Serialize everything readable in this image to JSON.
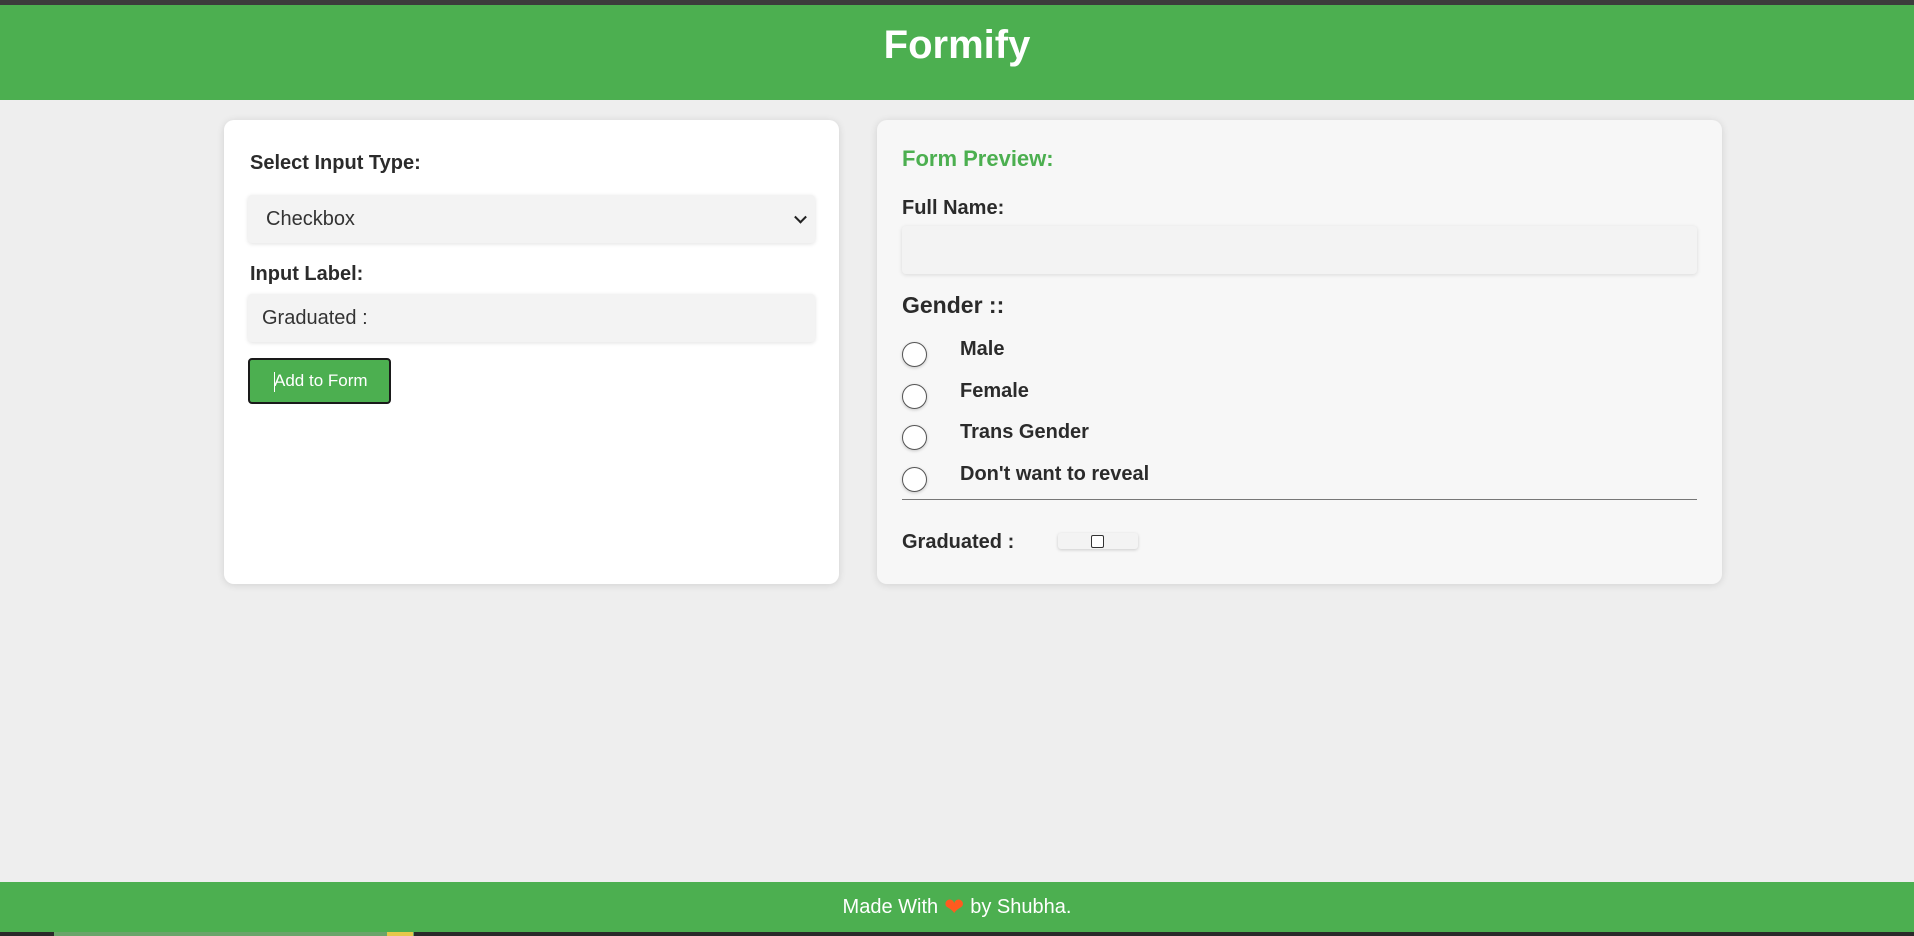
{
  "app": {
    "title": "Formify"
  },
  "builder": {
    "type_label": "Select Input Type:",
    "type_value": "Checkbox",
    "input_label_label": "Input Label:",
    "input_label_value": "Graduated :",
    "add_button": "Add to Form"
  },
  "preview": {
    "title": "Form Preview:",
    "full_name_label": "Full Name:",
    "full_name_value": "",
    "gender_title": "Gender ::",
    "gender_options": [
      {
        "label": "Male",
        "checked": false
      },
      {
        "label": "Female",
        "checked": false
      },
      {
        "label": "Trans Gender",
        "checked": false
      },
      {
        "label": "Don't want to reveal",
        "checked": false
      }
    ],
    "graduated_label": "Graduated :",
    "graduated_checked": false
  },
  "footer": {
    "prefix": "Made With",
    "heart_icon": "heart-icon",
    "suffix": "by Shubha."
  },
  "colors": {
    "brand": "#4caf50",
    "heart": "#ff5a1f",
    "background": "#eeeeee"
  }
}
